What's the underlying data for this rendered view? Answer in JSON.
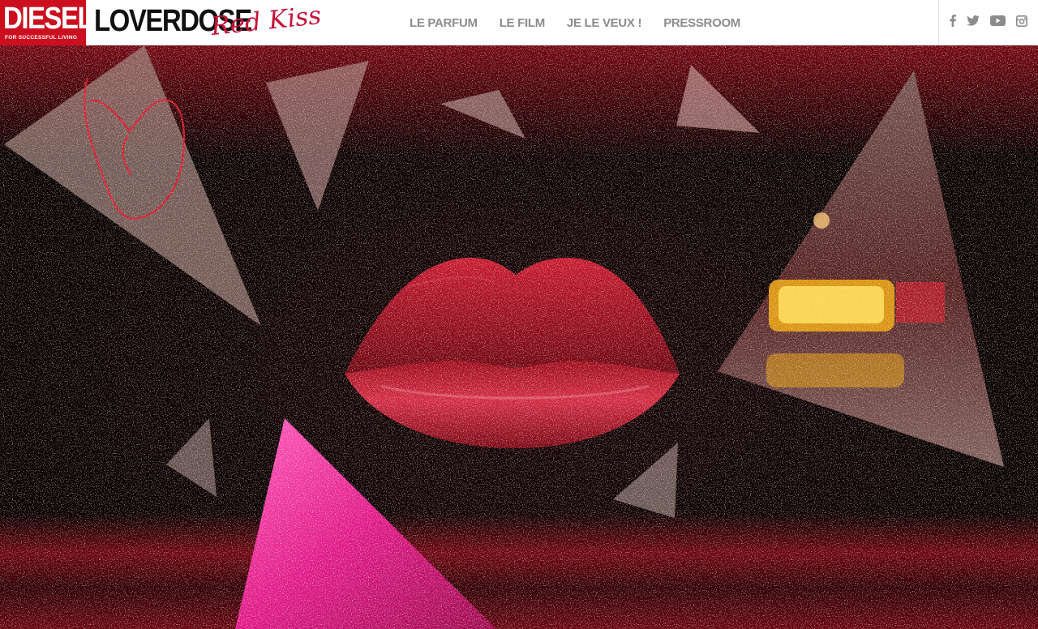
{
  "brand": {
    "logo_text": "DIESEL",
    "logo_tagline": "FOR SUCCESSFUL LIVING",
    "product_name": "LOVERDOSE",
    "product_script": "Red Kiss"
  },
  "nav": {
    "items": [
      {
        "label": "LE PARFUM"
      },
      {
        "label": "LE FILM"
      },
      {
        "label": "JE LE VEUX !"
      },
      {
        "label": "PRESSROOM"
      }
    ]
  },
  "social": [
    {
      "icon": "facebook-icon"
    },
    {
      "icon": "twitter-icon"
    },
    {
      "icon": "youtube-icon"
    },
    {
      "icon": "instagram-icon"
    }
  ],
  "colors": {
    "brand_red": "#cc0f1f",
    "script_red": "#c8123a",
    "nav_gray": "#8c8c8c",
    "lip_red": "#a6101f"
  }
}
